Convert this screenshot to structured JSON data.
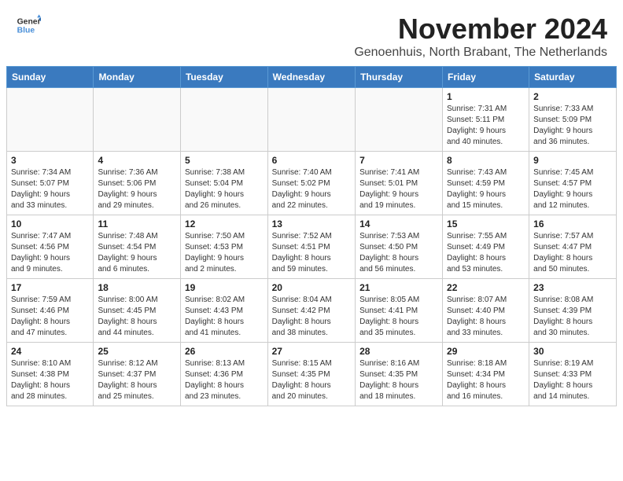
{
  "header": {
    "logo_line1": "General",
    "logo_line2": "Blue",
    "month_title": "November 2024",
    "subtitle": "Genoenhuis, North Brabant, The Netherlands"
  },
  "weekdays": [
    "Sunday",
    "Monday",
    "Tuesday",
    "Wednesday",
    "Thursday",
    "Friday",
    "Saturday"
  ],
  "weeks": [
    [
      {
        "day": "",
        "info": ""
      },
      {
        "day": "",
        "info": ""
      },
      {
        "day": "",
        "info": ""
      },
      {
        "day": "",
        "info": ""
      },
      {
        "day": "",
        "info": ""
      },
      {
        "day": "1",
        "info": "Sunrise: 7:31 AM\nSunset: 5:11 PM\nDaylight: 9 hours\nand 40 minutes."
      },
      {
        "day": "2",
        "info": "Sunrise: 7:33 AM\nSunset: 5:09 PM\nDaylight: 9 hours\nand 36 minutes."
      }
    ],
    [
      {
        "day": "3",
        "info": "Sunrise: 7:34 AM\nSunset: 5:07 PM\nDaylight: 9 hours\nand 33 minutes."
      },
      {
        "day": "4",
        "info": "Sunrise: 7:36 AM\nSunset: 5:06 PM\nDaylight: 9 hours\nand 29 minutes."
      },
      {
        "day": "5",
        "info": "Sunrise: 7:38 AM\nSunset: 5:04 PM\nDaylight: 9 hours\nand 26 minutes."
      },
      {
        "day": "6",
        "info": "Sunrise: 7:40 AM\nSunset: 5:02 PM\nDaylight: 9 hours\nand 22 minutes."
      },
      {
        "day": "7",
        "info": "Sunrise: 7:41 AM\nSunset: 5:01 PM\nDaylight: 9 hours\nand 19 minutes."
      },
      {
        "day": "8",
        "info": "Sunrise: 7:43 AM\nSunset: 4:59 PM\nDaylight: 9 hours\nand 15 minutes."
      },
      {
        "day": "9",
        "info": "Sunrise: 7:45 AM\nSunset: 4:57 PM\nDaylight: 9 hours\nand 12 minutes."
      }
    ],
    [
      {
        "day": "10",
        "info": "Sunrise: 7:47 AM\nSunset: 4:56 PM\nDaylight: 9 hours\nand 9 minutes."
      },
      {
        "day": "11",
        "info": "Sunrise: 7:48 AM\nSunset: 4:54 PM\nDaylight: 9 hours\nand 6 minutes."
      },
      {
        "day": "12",
        "info": "Sunrise: 7:50 AM\nSunset: 4:53 PM\nDaylight: 9 hours\nand 2 minutes."
      },
      {
        "day": "13",
        "info": "Sunrise: 7:52 AM\nSunset: 4:51 PM\nDaylight: 8 hours\nand 59 minutes."
      },
      {
        "day": "14",
        "info": "Sunrise: 7:53 AM\nSunset: 4:50 PM\nDaylight: 8 hours\nand 56 minutes."
      },
      {
        "day": "15",
        "info": "Sunrise: 7:55 AM\nSunset: 4:49 PM\nDaylight: 8 hours\nand 53 minutes."
      },
      {
        "day": "16",
        "info": "Sunrise: 7:57 AM\nSunset: 4:47 PM\nDaylight: 8 hours\nand 50 minutes."
      }
    ],
    [
      {
        "day": "17",
        "info": "Sunrise: 7:59 AM\nSunset: 4:46 PM\nDaylight: 8 hours\nand 47 minutes."
      },
      {
        "day": "18",
        "info": "Sunrise: 8:00 AM\nSunset: 4:45 PM\nDaylight: 8 hours\nand 44 minutes."
      },
      {
        "day": "19",
        "info": "Sunrise: 8:02 AM\nSunset: 4:43 PM\nDaylight: 8 hours\nand 41 minutes."
      },
      {
        "day": "20",
        "info": "Sunrise: 8:04 AM\nSunset: 4:42 PM\nDaylight: 8 hours\nand 38 minutes."
      },
      {
        "day": "21",
        "info": "Sunrise: 8:05 AM\nSunset: 4:41 PM\nDaylight: 8 hours\nand 35 minutes."
      },
      {
        "day": "22",
        "info": "Sunrise: 8:07 AM\nSunset: 4:40 PM\nDaylight: 8 hours\nand 33 minutes."
      },
      {
        "day": "23",
        "info": "Sunrise: 8:08 AM\nSunset: 4:39 PM\nDaylight: 8 hours\nand 30 minutes."
      }
    ],
    [
      {
        "day": "24",
        "info": "Sunrise: 8:10 AM\nSunset: 4:38 PM\nDaylight: 8 hours\nand 28 minutes."
      },
      {
        "day": "25",
        "info": "Sunrise: 8:12 AM\nSunset: 4:37 PM\nDaylight: 8 hours\nand 25 minutes."
      },
      {
        "day": "26",
        "info": "Sunrise: 8:13 AM\nSunset: 4:36 PM\nDaylight: 8 hours\nand 23 minutes."
      },
      {
        "day": "27",
        "info": "Sunrise: 8:15 AM\nSunset: 4:35 PM\nDaylight: 8 hours\nand 20 minutes."
      },
      {
        "day": "28",
        "info": "Sunrise: 8:16 AM\nSunset: 4:35 PM\nDaylight: 8 hours\nand 18 minutes."
      },
      {
        "day": "29",
        "info": "Sunrise: 8:18 AM\nSunset: 4:34 PM\nDaylight: 8 hours\nand 16 minutes."
      },
      {
        "day": "30",
        "info": "Sunrise: 8:19 AM\nSunset: 4:33 PM\nDaylight: 8 hours\nand 14 minutes."
      }
    ]
  ]
}
